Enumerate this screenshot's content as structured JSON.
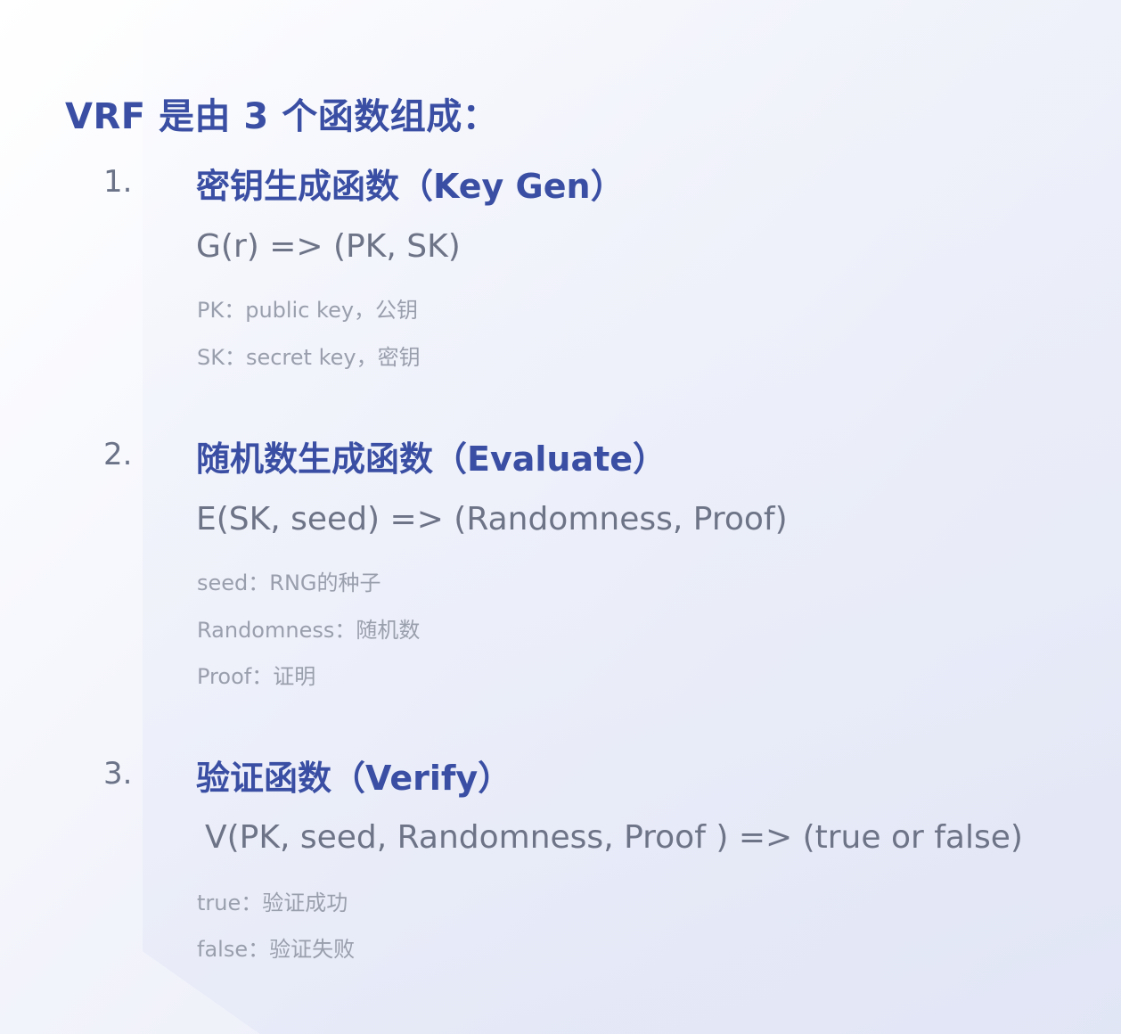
{
  "title": "VRF 是由 3 个函数组成：",
  "functions": [
    {
      "number": "1.",
      "heading": "密钥生成函数（Key Gen）",
      "formula": "G(r) => (PK, SK)",
      "notes": [
        "PK：public key，公钥",
        "SK：secret key，密钥"
      ]
    },
    {
      "number": "2.",
      "heading": "随机数生成函数（Evaluate）",
      "formula": "E(SK, seed) => (Randomness, Proof)",
      "notes": [
        "seed：RNG的种子",
        "Randomness：随机数",
        "Proof：证明"
      ]
    },
    {
      "number": "3.",
      "heading": "验证函数（Verify）",
      "formula": "V(PK, seed, Randomness, Proof ) => (true or false)",
      "notes": [
        "true：验证成功",
        "false：验证失败"
      ]
    }
  ]
}
